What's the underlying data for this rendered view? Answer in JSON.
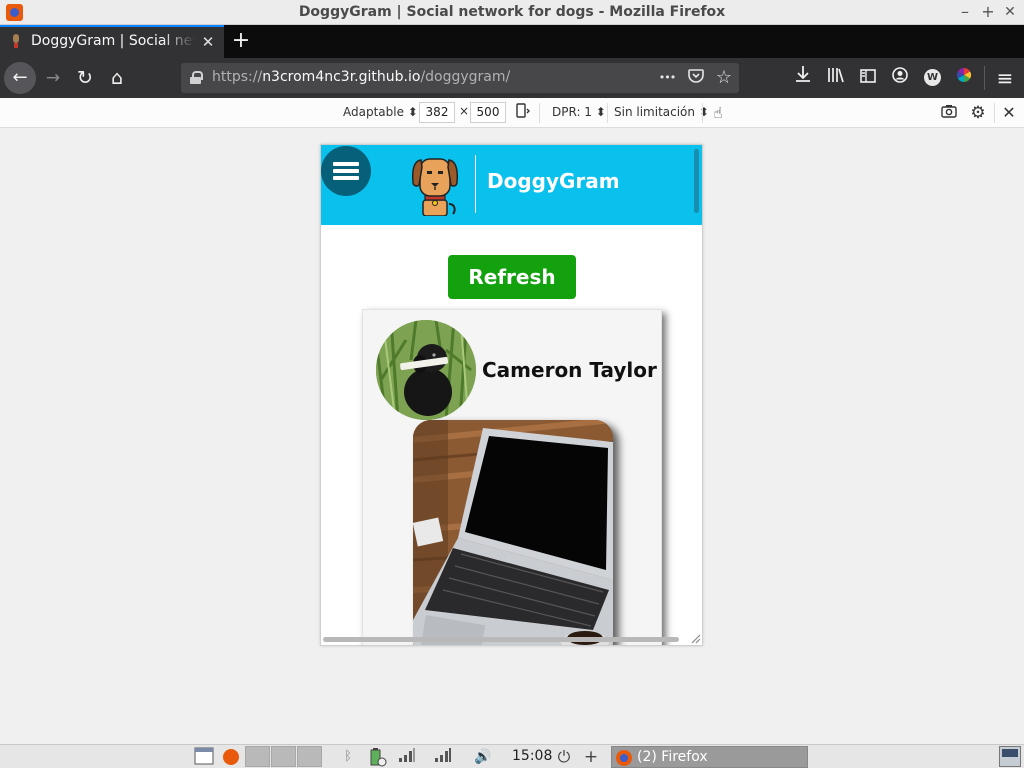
{
  "window": {
    "title": "DoggyGram | Social network for dogs - Mozilla Firefox",
    "minimize": "–",
    "maximize": "+",
    "close": "✕"
  },
  "tabs": {
    "active_title": "DoggyGram | Social network for dogs",
    "close_glyph": "✕",
    "new_tab_glyph": "+"
  },
  "toolbar": {
    "back_glyph": "←",
    "forward_glyph": "→",
    "reload_glyph": "↻",
    "home_glyph": "⌂",
    "url_scheme": "https://",
    "url_host": "n3crom4nc3r.github.io",
    "url_path": "/doggygram/",
    "page_actions_glyph": "•••",
    "pocket_glyph": "◡",
    "bookmark_glyph": "☆",
    "download_glyph": "⤓",
    "library_glyph": "|||\\",
    "sidebar_glyph": "▥",
    "account_glyph": "◉",
    "extension_w_label": "W",
    "menu_glyph": "≡"
  },
  "rdm": {
    "device_label": "Adaptable ⬍",
    "width_value": "382",
    "times": "×",
    "height_value": "500",
    "rotate_glyph": "⇄",
    "dpr_label": "DPR: 1 ⬍",
    "throttle_label": "Sin limitación ⬍",
    "touch_glyph": "☝",
    "screenshot_glyph": "⌷",
    "settings_glyph": "⚙",
    "close_glyph": "✕"
  },
  "site": {
    "title": "DoggyGram",
    "refresh_label": "Refresh",
    "post": {
      "author": "Cameron Taylor"
    }
  },
  "panel": {
    "clock": "15:08",
    "task_label": "(2) Firefox",
    "volume_glyph": "🔊",
    "power_glyph": "⏻",
    "add_glyph": "+",
    "bluetooth_glyph": "ᛒ"
  },
  "colors": {
    "header": "#0ac0ec",
    "hamburger": "#07607a",
    "refresh_button": "#13a10e",
    "firefox_chrome": "#323234",
    "tab_accent": "#0a84ff"
  }
}
